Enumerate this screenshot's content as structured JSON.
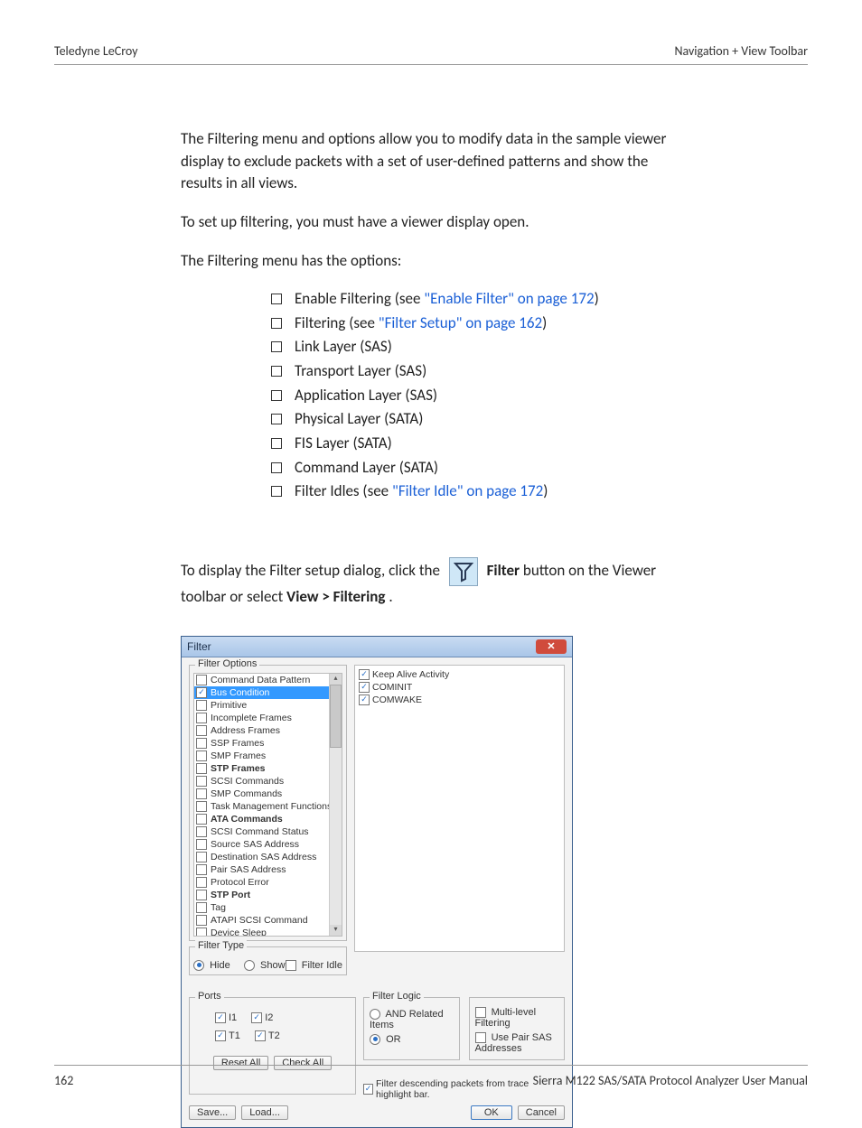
{
  "header": {
    "left": "Teledyne LeCroy",
    "right": "Navigation + View Toolbar"
  },
  "para1": "The Filtering menu and options allow you to modify data in the sample viewer display to exclude packets with a set of user-defined patterns and show the results in all views.",
  "para2": "To set up filtering, you must have a viewer display open.",
  "para3": "The Filtering menu has the options:",
  "list": [
    {
      "pre": "Enable Filtering (see ",
      "link": "\"Enable Filter\" on page 172",
      "post": ")"
    },
    {
      "pre": "Filtering (see ",
      "link": "\"Filter Setup\" on page 162",
      "post": ")"
    },
    {
      "pre": "Link Layer (SAS)"
    },
    {
      "pre": "Transport Layer (SAS)"
    },
    {
      "pre": "Application Layer (SAS)"
    },
    {
      "pre": "Physical Layer (SATA)"
    },
    {
      "pre": "FIS Layer (SATA)"
    },
    {
      "pre": "Command Layer (SATA)"
    },
    {
      "pre": "Filter Idles (see ",
      "link": "\"Filter Idle\" on page 172",
      "post": ")"
    }
  ],
  "para4a": "To display the Filter setup dialog, click the ",
  "para4b": " Filter",
  "para4c": " button on the Viewer toolbar or select ",
  "para4d": "View > Filtering",
  "para4e": ".",
  "dlg": {
    "title": "Filter",
    "close": "✕",
    "filterOptionsTitle": "Filter Options",
    "options": [
      {
        "label": "Command Data Pattern",
        "checked": false
      },
      {
        "label": "Bus Condition",
        "checked": true,
        "selected": true
      },
      {
        "label": "Primitive",
        "checked": false
      },
      {
        "label": "Incomplete Frames",
        "checked": false
      },
      {
        "label": "Address Frames",
        "checked": false
      },
      {
        "label": "SSP Frames",
        "checked": false
      },
      {
        "label": "SMP Frames",
        "checked": false
      },
      {
        "label": "STP Frames",
        "checked": false,
        "bold": true
      },
      {
        "label": "SCSI Commands",
        "checked": false
      },
      {
        "label": "SMP Commands",
        "checked": false
      },
      {
        "label": "Task Management Functions",
        "checked": false
      },
      {
        "label": "ATA Commands",
        "checked": false,
        "bold": true
      },
      {
        "label": "SCSI Command Status",
        "checked": false
      },
      {
        "label": "Source SAS Address",
        "checked": false
      },
      {
        "label": "Destination SAS Address",
        "checked": false
      },
      {
        "label": "Pair SAS Address",
        "checked": false
      },
      {
        "label": "Protocol Error",
        "checked": false
      },
      {
        "label": "STP Port",
        "checked": false,
        "bold": true
      },
      {
        "label": "Tag",
        "checked": false
      },
      {
        "label": "ATAPI SCSI Command",
        "checked": false
      },
      {
        "label": "Device Sleep",
        "checked": false
      }
    ],
    "rightTop": [
      {
        "label": "Keep Alive Activity",
        "checked": true
      },
      {
        "label": "COMINIT",
        "checked": true
      },
      {
        "label": "COMWAKE",
        "checked": true
      }
    ],
    "filterTypeTitle": "Filter Type",
    "ftHide": "Hide",
    "ftShow": "Show",
    "filterIdle": "Filter Idle",
    "portsTitle": "Ports",
    "ports": [
      [
        "I1",
        "I2"
      ],
      [
        "T1",
        "T2"
      ]
    ],
    "resetAll": "Reset All",
    "checkAll": "Check All",
    "flTitle": "Filter Logic",
    "flAnd": "AND Related Items",
    "flOr": "OR",
    "mlTitle": "Multi-level Filtering",
    "usePair": "Use Pair SAS Addresses",
    "descend": "Filter descending packets from trace highlight bar.",
    "save": "Save...",
    "load": "Load...",
    "ok": "OK",
    "cancel": "Cancel"
  },
  "footer": {
    "page": "162",
    "manual": "Sierra M122 SAS/SATA Protocol Analyzer User Manual"
  }
}
